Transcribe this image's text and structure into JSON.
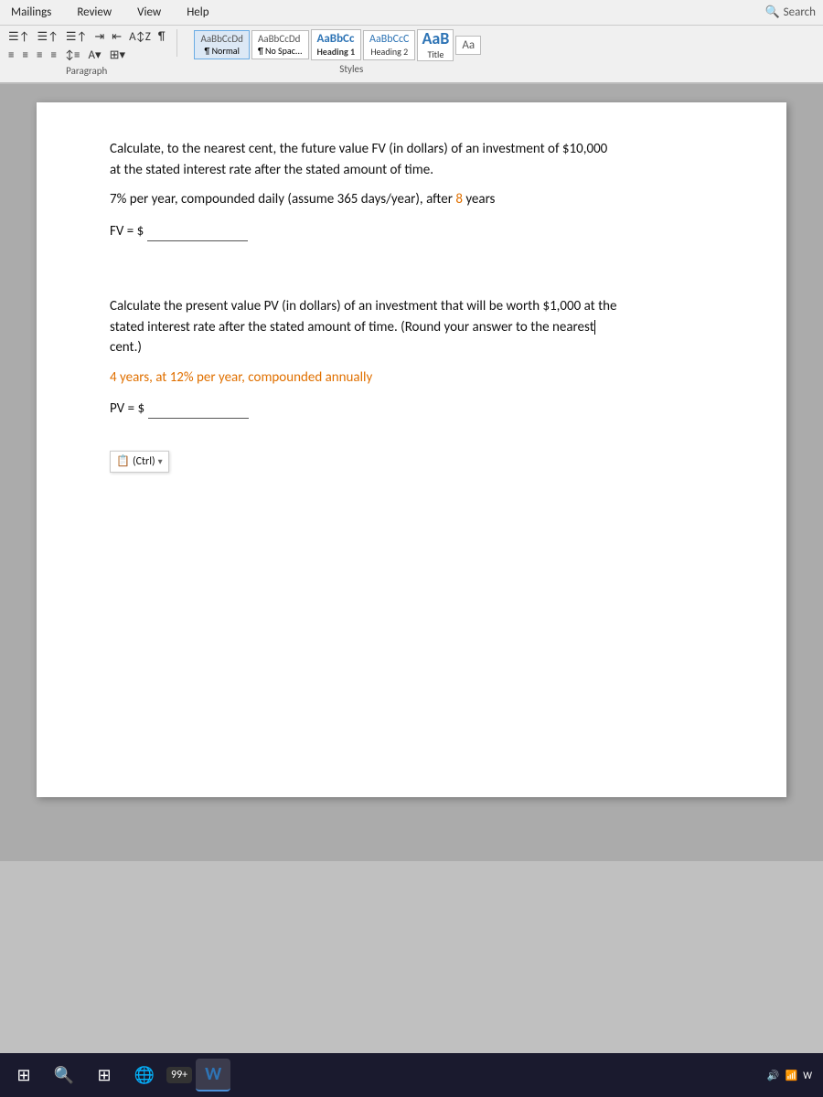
{
  "menu": {
    "items": [
      "Mailings",
      "Review",
      "View",
      "Help"
    ],
    "search_placeholder": "Search",
    "search_icon": "🔍"
  },
  "ribbon": {
    "paragraph_label": "Paragraph",
    "styles_label": "Styles",
    "styles": [
      {
        "id": "normal",
        "label": "¶ Normal",
        "active": true
      },
      {
        "id": "nospace",
        "label": "¶ No Spac...",
        "active": false
      },
      {
        "id": "heading1",
        "label": "Heading 1",
        "active": false
      },
      {
        "id": "heading2",
        "label": "Heading 2",
        "active": false
      },
      {
        "id": "title",
        "label": "Title",
        "active": false
      }
    ],
    "aabbc_samples": [
      "AaBbCcDd",
      "AaBbCcDd",
      "AaBbCc",
      "AaBbCcC",
      "AaB"
    ],
    "aa_label": "Aa"
  },
  "document": {
    "problem1": {
      "text1": "Calculate, to the nearest cent, the future value FV (in dollars) of an investment of $10,000",
      "text2": "at the stated interest rate after the stated amount of time.",
      "condition": "7% per year, compounded daily (assume 365 days/year), after ",
      "highlight_value": "8",
      "highlight_color_label": "orange",
      "condition_suffix": " years",
      "answer_label": "FV = $"
    },
    "problem2": {
      "text1": "Calculate the present value PV (in dollars) of an investment that will be worth $1,000 at the",
      "text2": "stated interest rate after the stated amount of time. (Round your answer to the nearest",
      "text3": "cent.)",
      "condition": "4 years, at ",
      "highlight_value": "12%",
      "highlight_color_label": "orange",
      "condition_suffix": " per year, compounded annually",
      "answer_label": "PV = $",
      "ctrl_label": "(Ctrl)"
    }
  },
  "taskbar": {
    "start_icon": "⊞",
    "badge_count": "99+",
    "app_label": "W"
  }
}
